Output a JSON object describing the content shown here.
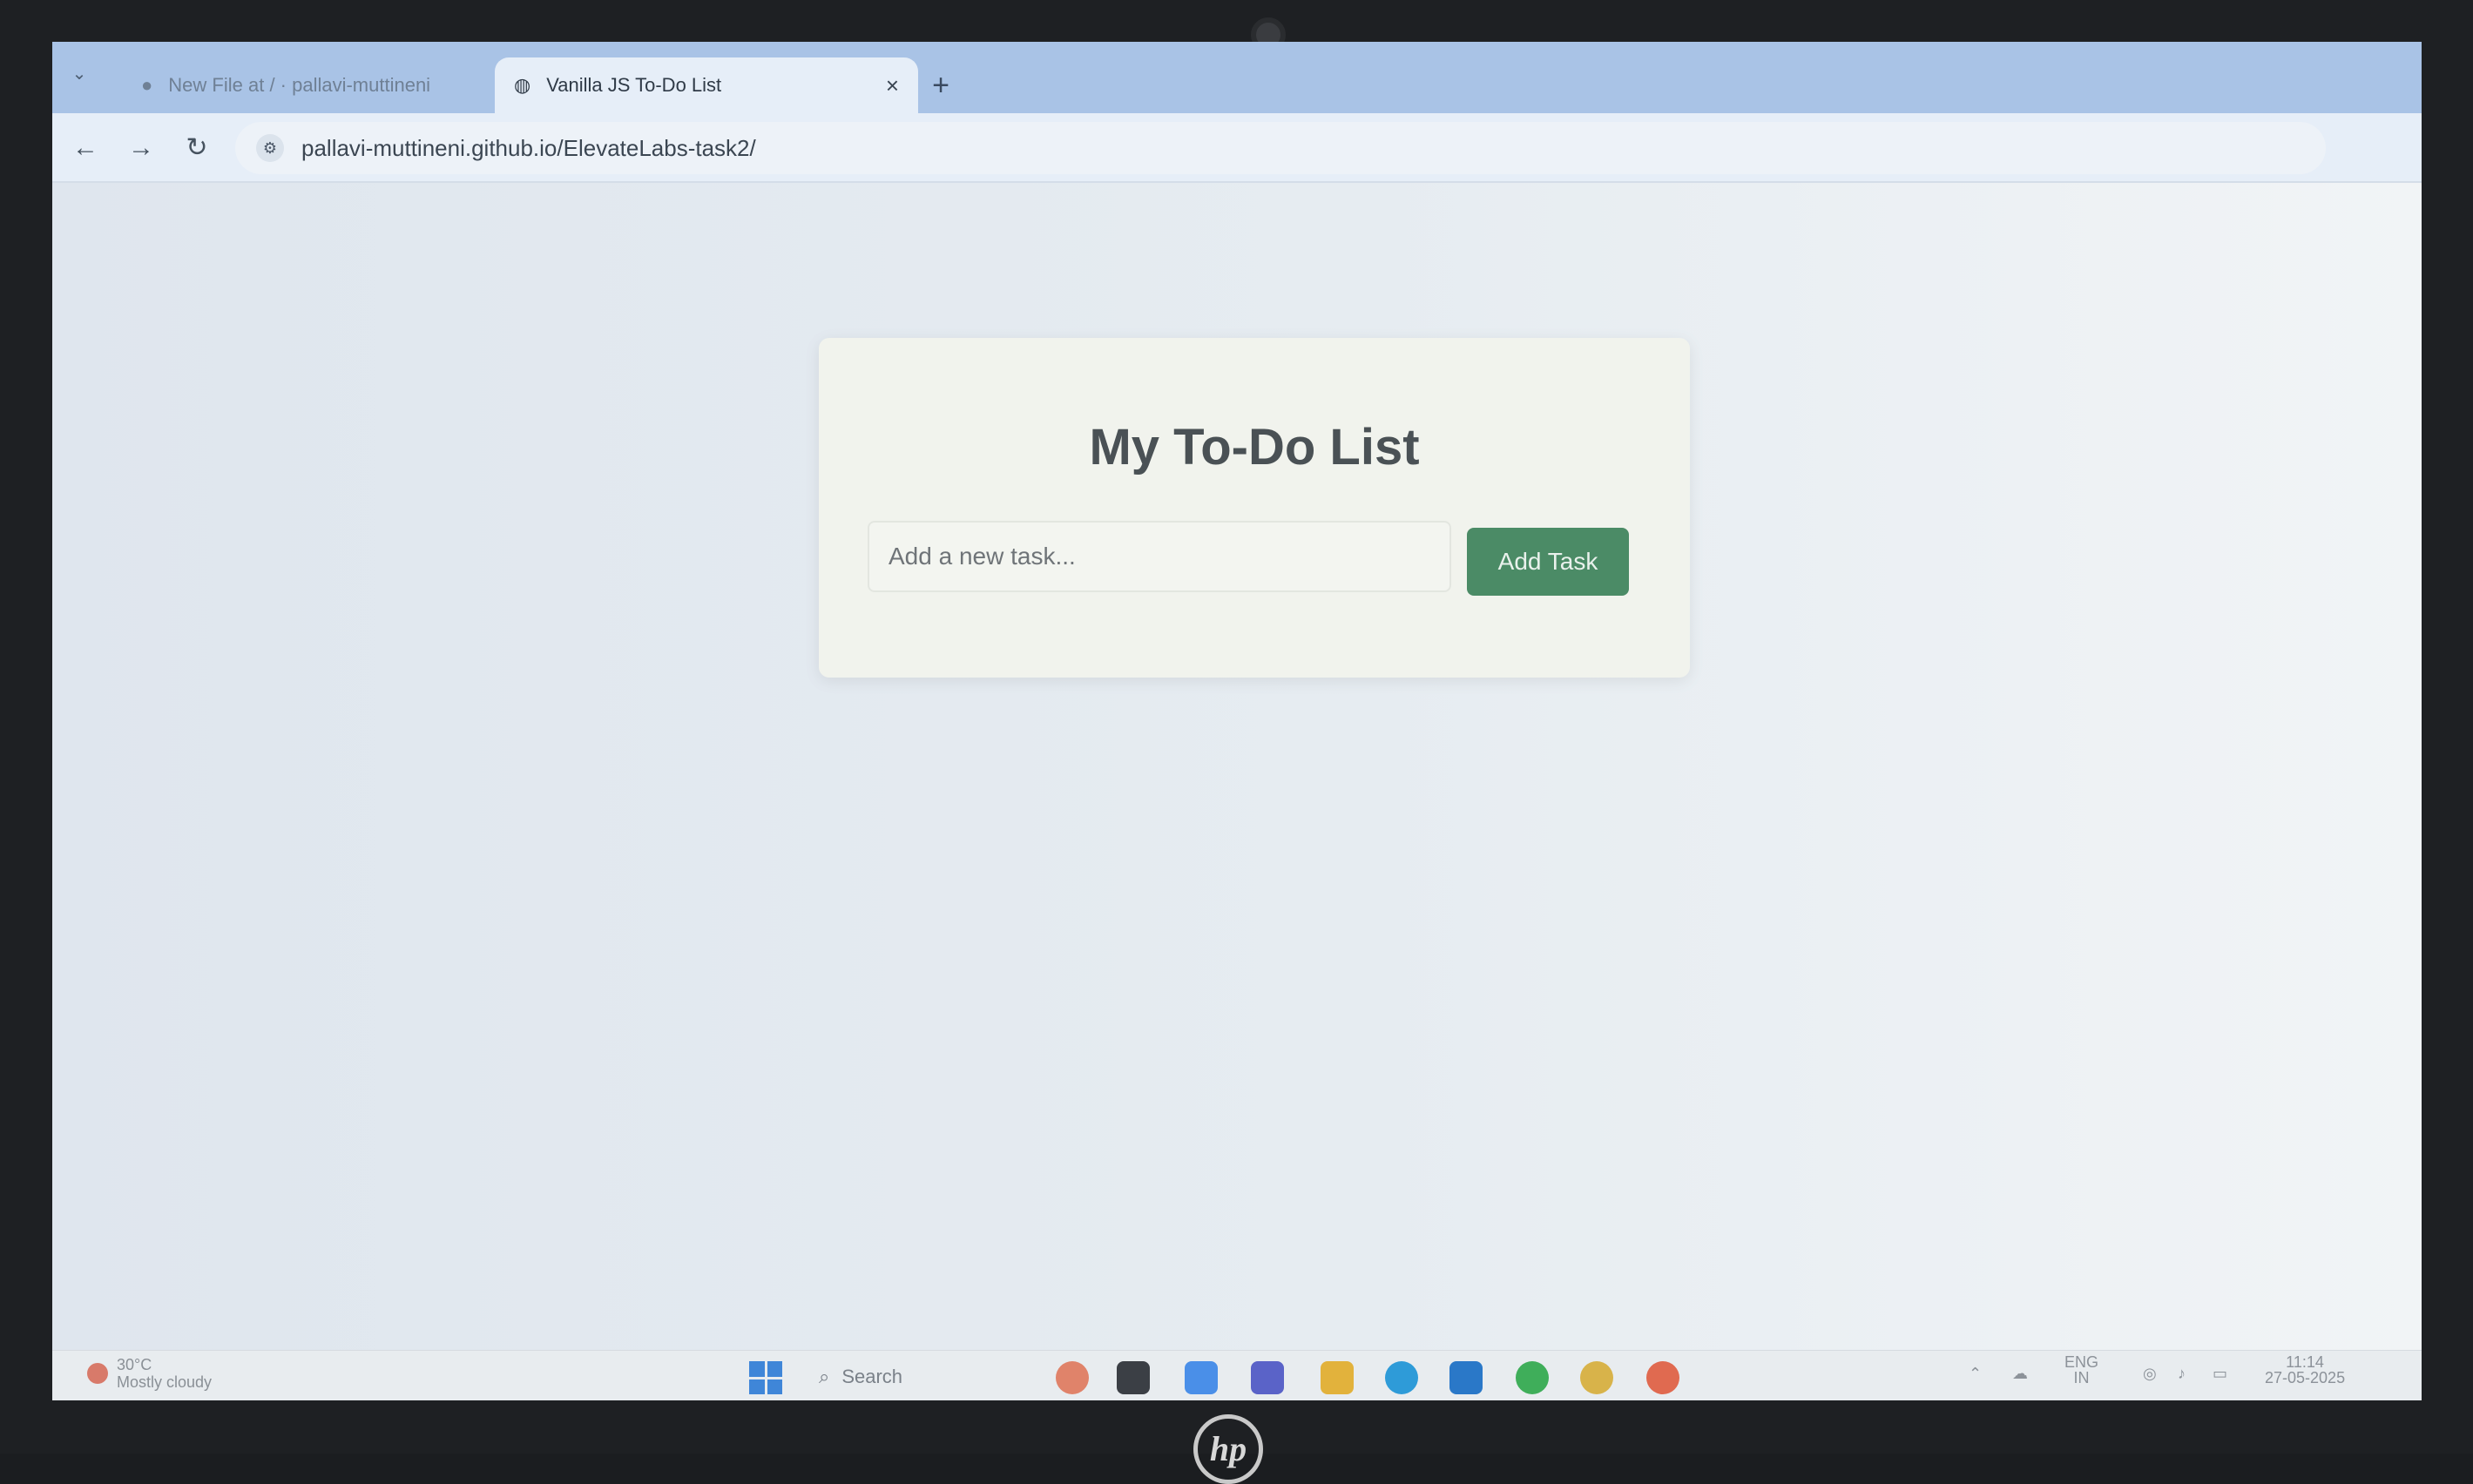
{
  "browser": {
    "tabs": [
      {
        "title": "New File at / · pallavi-muttineni",
        "icon": "github-icon",
        "active": false
      },
      {
        "title": "Vanilla JS To-Do List",
        "icon": "globe-icon",
        "active": true
      }
    ],
    "url": "pallavi-muttineni.github.io/ElevateLabs-task2/"
  },
  "app": {
    "title": "My To-Do List",
    "input_placeholder": "Add a new task...",
    "add_button_label": "Add Task",
    "accent_color": "#4b8b66"
  },
  "taskbar": {
    "weather_temp": "30°C",
    "weather_desc": "Mostly cloudy",
    "search_label": "Search",
    "lang_top": "ENG",
    "lang_bottom": "IN",
    "time": "11:14",
    "date": "27-05-2025"
  }
}
